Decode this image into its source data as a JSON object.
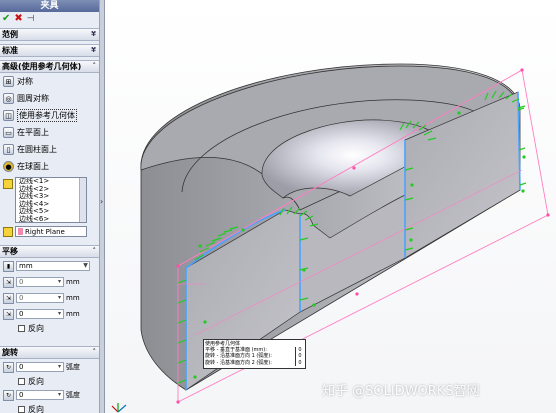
{
  "panel": {
    "title": "夹具",
    "sections": {
      "offset": "范例",
      "standard": "标准",
      "advanced": "高级(使用参考几何体)"
    },
    "options": [
      {
        "label": "对称",
        "icon": "symmetry-icon"
      },
      {
        "label": "圆周对称",
        "icon": "circular-symmetry-icon"
      },
      {
        "label": "使用参考几何体",
        "icon": "reference-geometry-icon"
      },
      {
        "label": "在平面上",
        "icon": "on-flat-face-icon"
      },
      {
        "label": "在圆柱面上",
        "icon": "on-cylindrical-face-icon"
      },
      {
        "label": "在球面上",
        "icon": "on-spherical-face-icon"
      }
    ],
    "faces_list": [
      "边线<1>",
      "边线<2>",
      "边线<3>",
      "边线<4>",
      "边线<5>",
      "边线<6>"
    ],
    "reference_plane": "Right Plane",
    "translation": {
      "header": "平移",
      "unit": "mm",
      "values": [
        "0",
        "0",
        "0"
      ],
      "unit_label": "mm",
      "reverse": "反向"
    },
    "rotation": {
      "header": "旋转",
      "values": [
        "0",
        "0",
        "0"
      ],
      "unit_label": "弧度",
      "reverse": "反向"
    }
  },
  "callout": {
    "title": "使用参考几何体",
    "rows": [
      {
        "label": "平移 - 垂直于基准面 (mm):",
        "value": "0"
      },
      {
        "label": "旋转 - 沿基准面方向 1 (弧度):",
        "value": "0"
      },
      {
        "label": "旋转 - 沿基准面方向 2 (弧度):",
        "value": "0"
      }
    ]
  },
  "watermark": "知乎 @SOLIDWORKS智网",
  "colors": {
    "panel_bg": "#e8ecf4",
    "title_bar": "#56699a",
    "part_face": "#a5a5ab",
    "fixture_arrow": "#22cc22",
    "plane_outline": "#ff7fc0",
    "edge_highlight": "#4aa3ff"
  }
}
